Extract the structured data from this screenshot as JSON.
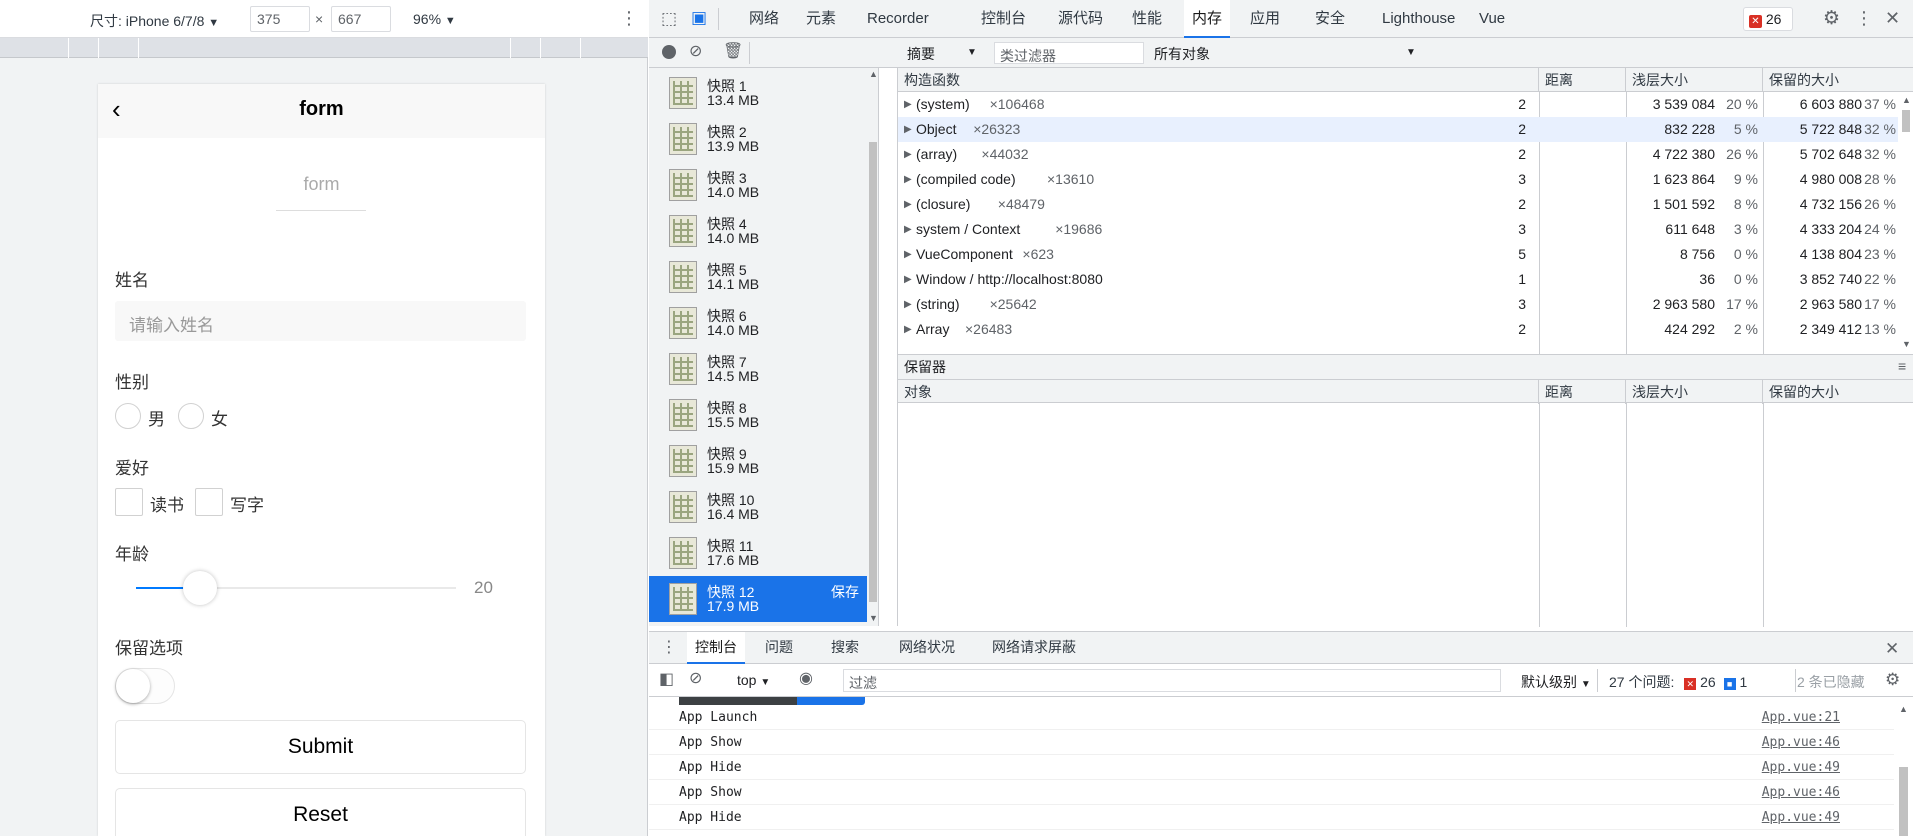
{
  "device_toolbar": {
    "dimensions_label": "尺寸: iPhone 6/7/8",
    "width": "375",
    "times": "×",
    "height": "667",
    "zoom": "96%"
  },
  "phone": {
    "title": "form",
    "subtitle": "form",
    "name_label": "姓名",
    "name_placeholder": "请输入姓名",
    "gender_label": "性别",
    "gender_options": [
      "男",
      "女"
    ],
    "hobby_label": "爱好",
    "hobby_options": [
      "读书",
      "写字"
    ],
    "age_label": "年龄",
    "age_value": "20",
    "age_fraction": 0.2,
    "keep_label": "保留选项",
    "submit": "Submit",
    "reset": "Reset"
  },
  "devtools": {
    "tabs": [
      "网络",
      "元素",
      "Recorder",
      "控制台",
      "源代码",
      "性能",
      "内存",
      "应用",
      "安全",
      "Lighthouse",
      "Vue"
    ],
    "active_tab": "内存",
    "error_count": "26",
    "memory_toolbar": {
      "view": "摘要",
      "class_filter_placeholder": "类过滤器",
      "object_filter": "所有对象"
    },
    "snapshots": [
      {
        "name": "快照 1",
        "size": "13.4 MB"
      },
      {
        "name": "快照 2",
        "size": "13.9 MB"
      },
      {
        "name": "快照 3",
        "size": "14.0 MB"
      },
      {
        "name": "快照 4",
        "size": "14.0 MB"
      },
      {
        "name": "快照 5",
        "size": "14.1 MB"
      },
      {
        "name": "快照 6",
        "size": "14.0 MB"
      },
      {
        "name": "快照 7",
        "size": "14.5 MB"
      },
      {
        "name": "快照 8",
        "size": "15.5 MB"
      },
      {
        "name": "快照 9",
        "size": "15.9 MB"
      },
      {
        "name": "快照 10",
        "size": "16.4 MB"
      },
      {
        "name": "快照 11",
        "size": "17.6 MB"
      },
      {
        "name": "快照 12",
        "size": "17.9 MB"
      }
    ],
    "selected_snapshot_save": "保存",
    "heap_columns": [
      "构造函数",
      "距离",
      "浅层大小",
      "保留的大小"
    ],
    "heap_rows": [
      {
        "name": "(system)",
        "count": "×106468",
        "distance": "2",
        "shallow": "3 539 084",
        "shallow_pct": "20 %",
        "retained": "6 603 880",
        "retained_pct": "37 %"
      },
      {
        "name": "Object",
        "count": "×26323",
        "distance": "2",
        "shallow": "832 228",
        "shallow_pct": "5 %",
        "retained": "5 722 848",
        "retained_pct": "32 %"
      },
      {
        "name": "(array)",
        "count": "×44032",
        "distance": "2",
        "shallow": "4 722 380",
        "shallow_pct": "26 %",
        "retained": "5 702 648",
        "retained_pct": "32 %"
      },
      {
        "name": "(compiled code)",
        "count": "×13610",
        "distance": "3",
        "shallow": "1 623 864",
        "shallow_pct": "9 %",
        "retained": "4 980 008",
        "retained_pct": "28 %"
      },
      {
        "name": "(closure)",
        "count": "×48479",
        "distance": "2",
        "shallow": "1 501 592",
        "shallow_pct": "8 %",
        "retained": "4 732 156",
        "retained_pct": "26 %"
      },
      {
        "name": "system / Context",
        "count": "×19686",
        "distance": "3",
        "shallow": "611 648",
        "shallow_pct": "3 %",
        "retained": "4 333 204",
        "retained_pct": "24 %"
      },
      {
        "name": "VueComponent",
        "count": "×623",
        "distance": "5",
        "shallow": "8 756",
        "shallow_pct": "0 %",
        "retained": "4 138 804",
        "retained_pct": "23 %"
      },
      {
        "name": "Window / http://localhost:8080",
        "count": "",
        "distance": "1",
        "shallow": "36",
        "shallow_pct": "0 %",
        "retained": "3 852 740",
        "retained_pct": "22 %"
      },
      {
        "name": "(string)",
        "count": "×25642",
        "distance": "3",
        "shallow": "2 963 580",
        "shallow_pct": "17 %",
        "retained": "2 963 580",
        "retained_pct": "17 %"
      },
      {
        "name": "Array",
        "count": "×26483",
        "distance": "2",
        "shallow": "424 292",
        "shallow_pct": "2 %",
        "retained": "2 349 412",
        "retained_pct": "13 %"
      }
    ],
    "retainers_title": "保留器",
    "retainer_columns": [
      "对象",
      "距离",
      "浅层大小",
      "保留的大小"
    ],
    "drawer_tabs": [
      "控制台",
      "问题",
      "搜索",
      "网络状况",
      "网络请求屏蔽"
    ],
    "console_toolbar": {
      "context": "top",
      "filter_placeholder": "过滤",
      "level": "默认级别",
      "issues_label": "27 个问题:",
      "issues_errors": "26",
      "issues_info": "1",
      "hidden": "2 条已隐藏"
    },
    "logs": [
      {
        "msg": "App Launch",
        "src": "App.vue:21"
      },
      {
        "msg": "App Show",
        "src": "App.vue:46"
      },
      {
        "msg": "App Hide",
        "src": "App.vue:49"
      },
      {
        "msg": "App Show",
        "src": "App.vue:46"
      },
      {
        "msg": "App Hide",
        "src": "App.vue:49"
      }
    ]
  }
}
